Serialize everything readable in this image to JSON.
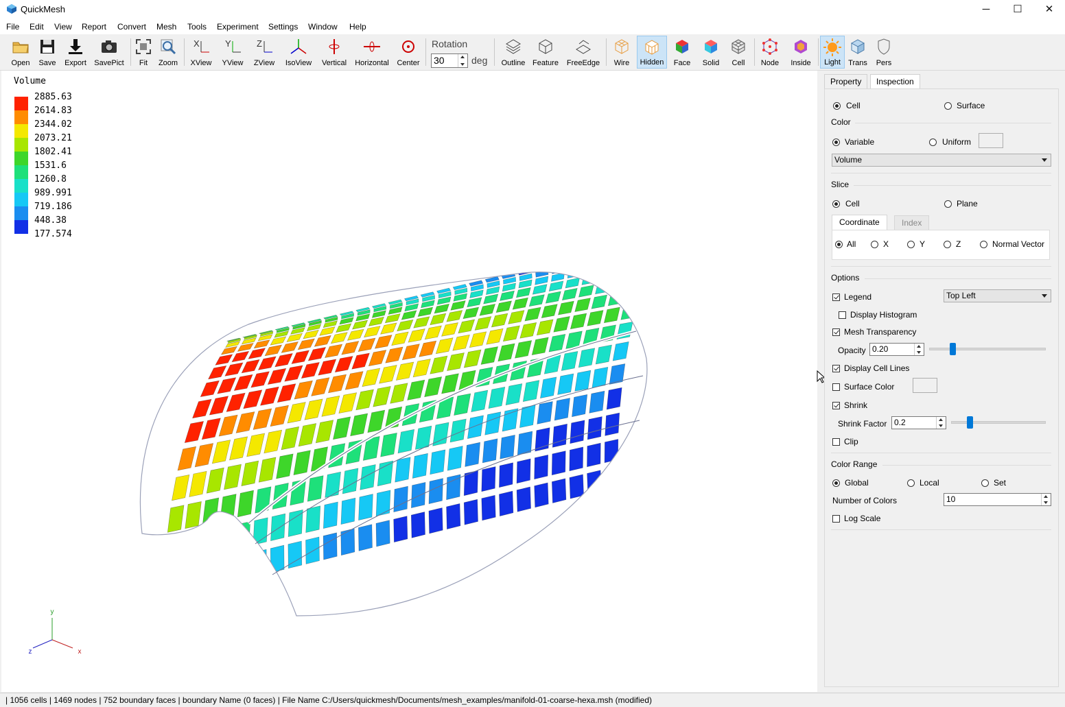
{
  "app": {
    "title": "QuickMesh"
  },
  "window_controls": {
    "minimize": "─",
    "maximize": "☐",
    "close": "✕"
  },
  "menu": [
    "File",
    "Edit",
    "View",
    "Report",
    "Convert",
    "Mesh",
    "Tools",
    "Experiment",
    "Settings",
    "Window",
    "Help"
  ],
  "toolbar": {
    "buttons": [
      {
        "label": "Open",
        "icon": "folder-icon"
      },
      {
        "label": "Save",
        "icon": "floppy-icon"
      },
      {
        "label": "Export",
        "icon": "download-icon"
      },
      {
        "label": "SavePict",
        "icon": "camera-icon"
      },
      {
        "label": "Fit",
        "icon": "fit-icon"
      },
      {
        "label": "Zoom",
        "icon": "zoom-icon"
      },
      {
        "label": "XView",
        "icon": "xview-icon"
      },
      {
        "label": "YView",
        "icon": "yview-icon"
      },
      {
        "label": "ZView",
        "icon": "zview-icon"
      },
      {
        "label": "IsoView",
        "icon": "isoview-icon"
      },
      {
        "label": "Vertical",
        "icon": "vertical-rotate-icon"
      },
      {
        "label": "Horizontal",
        "icon": "horizontal-rotate-icon"
      },
      {
        "label": "Center",
        "icon": "center-icon"
      },
      {
        "label": "Outline",
        "icon": "outline-icon"
      },
      {
        "label": "Feature",
        "icon": "feature-icon"
      },
      {
        "label": "FreeEdge",
        "icon": "freeedge-icon"
      },
      {
        "label": "Wire",
        "icon": "wire-icon"
      },
      {
        "label": "Hidden",
        "icon": "hidden-icon"
      },
      {
        "label": "Face",
        "icon": "face-icon"
      },
      {
        "label": "Solid",
        "icon": "solid-icon"
      },
      {
        "label": "Cell",
        "icon": "cell-icon"
      },
      {
        "label": "Node",
        "icon": "node-icon"
      },
      {
        "label": "Inside",
        "icon": "inside-icon"
      },
      {
        "label": "Light",
        "icon": "light-icon"
      },
      {
        "label": "Trans",
        "icon": "trans-icon"
      },
      {
        "label": "Pers",
        "icon": "pers-icon"
      }
    ],
    "active": [
      "Hidden",
      "Light"
    ],
    "rotation_label": "Rotation",
    "rotation_value": "30",
    "rotation_unit": "deg"
  },
  "legend": {
    "title": "Volume",
    "values": [
      "2885.63",
      "2614.83",
      "2344.02",
      "2073.21",
      "1802.41",
      "1531.6",
      "1260.8",
      "989.991",
      "719.186",
      "448.38",
      "177.574"
    ],
    "colors": [
      "#ff2200",
      "#ff8c00",
      "#f4e800",
      "#a8e600",
      "#3ed62a",
      "#1ee07a",
      "#19e0c8",
      "#16c8f5",
      "#1a8df0",
      "#1230e6"
    ]
  },
  "axes": {
    "x": "x",
    "y": "y",
    "z": "z"
  },
  "panel": {
    "tabs": [
      "Property",
      "Inspection"
    ],
    "active_tab": "Inspection",
    "cell_label": "Cell",
    "surface_label": "Surface",
    "color": {
      "title": "Color",
      "variable_label": "Variable",
      "uniform_label": "Uniform",
      "variable_selected": "Volume"
    },
    "slice": {
      "title": "Slice",
      "cell_label": "Cell",
      "plane_label": "Plane",
      "subtabs": [
        "Coordinate",
        "Index"
      ],
      "options": [
        "All",
        "X",
        "Y",
        "Z",
        "Normal Vector"
      ]
    },
    "options": {
      "title": "Options",
      "legend_label": "Legend",
      "legend_position": "Top Left",
      "display_histogram": "Display Histogram",
      "mesh_transparency": "Mesh Transparency",
      "opacity_label": "Opacity",
      "opacity_value": "0.20",
      "opacity_fraction": 0.2,
      "display_cell_lines": "Display Cell Lines",
      "surface_color": "Surface Color",
      "shrink_label": "Shrink",
      "shrink_factor_label": "Shrink Factor",
      "shrink_factor_value": "0.2",
      "shrink_fraction": 0.2,
      "clip_label": "Clip"
    },
    "color_range": {
      "title": "Color Range",
      "global_label": "Global",
      "local_label": "Local",
      "set_label": "Set",
      "num_colors_label": "Number of Colors",
      "num_colors_value": "10",
      "log_scale_label": "Log Scale"
    }
  },
  "status": "| 1056 cells | 1469 nodes | 752 boundary faces |  boundary Name  (0 faces) | File Name C:/Users/quickmesh/Documents/mesh_examples/manifold-01-coarse-hexa.msh (modified)"
}
